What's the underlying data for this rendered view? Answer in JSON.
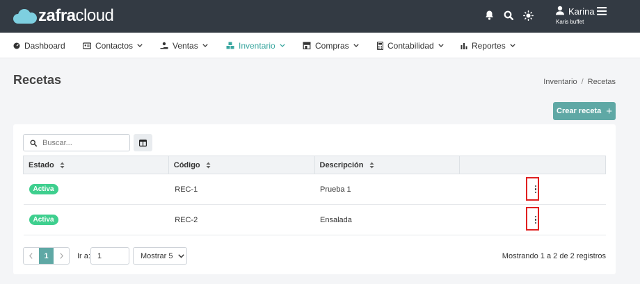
{
  "app": {
    "logo_bold": "zafra",
    "logo_light": "cloud"
  },
  "user": {
    "name": "Karina",
    "subtitle": "Karis buffet"
  },
  "nav": {
    "items": [
      {
        "label": "Dashboard"
      },
      {
        "label": "Contactos"
      },
      {
        "label": "Ventas"
      },
      {
        "label": "Inventario",
        "active": true
      },
      {
        "label": "Compras"
      },
      {
        "label": "Contabilidad"
      },
      {
        "label": "Reportes"
      }
    ]
  },
  "page": {
    "title": "Recetas",
    "create_label": "Crear receta",
    "create_plus": "+"
  },
  "breadcrumb": {
    "parent": "Inventario",
    "separator": "/",
    "current": "Recetas"
  },
  "search": {
    "placeholder": "Buscar..."
  },
  "table": {
    "headers": {
      "estado": "Estado",
      "codigo": "Código",
      "descripcion": "Descripción"
    },
    "rows": [
      {
        "estado": "Activa",
        "codigo": "REC-1",
        "descripcion": "Prueba 1"
      },
      {
        "estado": "Activa",
        "codigo": "REC-2",
        "descripcion": "Ensalada"
      }
    ]
  },
  "pagination": {
    "current_page": "1",
    "goto_label": "Ir a:",
    "goto_value": "1",
    "show_label": "Mostrar 5",
    "summary": "Mostrando 1 a 2 de 2 registros"
  },
  "colors": {
    "topbar": "#333a43",
    "accent": "#5fa8a5",
    "active_nav": "#3ba7a0",
    "badge": "#3ecf8e",
    "highlight": "#e02020"
  }
}
